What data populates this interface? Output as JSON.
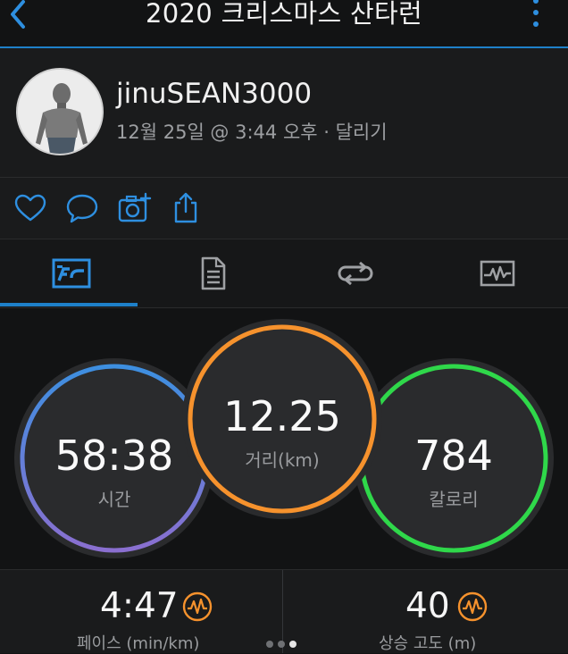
{
  "header": {
    "title": "2020 크리스마스 산타런"
  },
  "profile": {
    "username": "jinuSEAN3000",
    "meta": "12월 25일 @ 3:44 오후 · 달리기"
  },
  "actions": [
    "like-icon",
    "comment-icon",
    "add-photo-icon",
    "share-icon"
  ],
  "tabs": [
    "stats-tab",
    "details-tab",
    "laps-tab",
    "chart-tab"
  ],
  "stats": {
    "time": {
      "value": "58:38",
      "label": "시간"
    },
    "distance": {
      "value": "12.25",
      "label": "거리(km)"
    },
    "calories": {
      "value": "784",
      "label": "칼로리"
    }
  },
  "bottom": {
    "pace": {
      "value": "4:47",
      "label": "페이스 (min/km)"
    },
    "ascent": {
      "value": "40",
      "label": "상승 고도 (m)"
    }
  },
  "colors": {
    "accent": "#1e80c9",
    "orange": "#f6922d",
    "green": "#2fd84a",
    "blue": "#3d8fe0",
    "purple": "#8a6fd0"
  }
}
